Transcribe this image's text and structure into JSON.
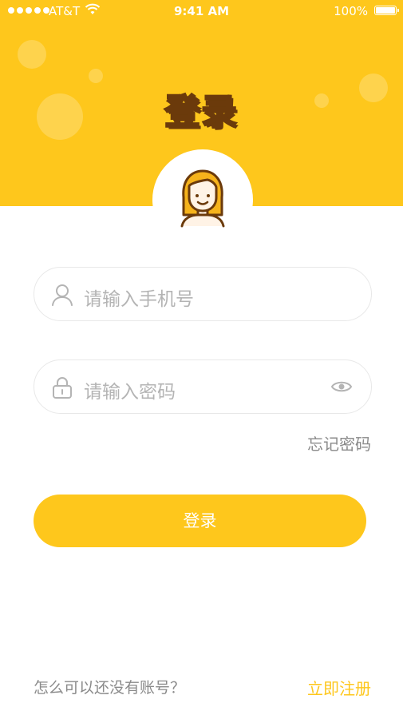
{
  "status_bar": {
    "carrier": "AT&T",
    "time": "9:41 AM",
    "battery": "100%"
  },
  "header": {
    "title": "登录"
  },
  "form": {
    "phone_placeholder": "请输入手机号",
    "password_placeholder": "请输入密码",
    "forgot_password": "忘记密码",
    "login_button": "登录"
  },
  "footer": {
    "no_account": "怎么可以还没有账号？",
    "register": "立即注册"
  },
  "colors": {
    "brand_yellow": "#FEC71C",
    "title_outline": "#6B3A0B",
    "placeholder_gray": "#B4B4B4"
  },
  "icons": [
    "signal-dots-icon",
    "wifi-icon",
    "battery-icon",
    "user-icon",
    "lock-icon",
    "eye-icon",
    "avatar-girl-icon"
  ]
}
